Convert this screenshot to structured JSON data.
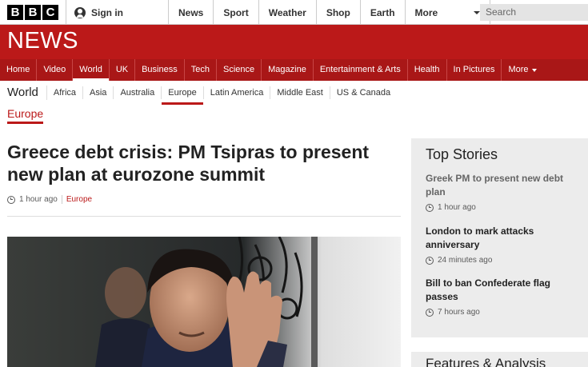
{
  "brand": {
    "logo_letters": [
      "B",
      "B",
      "C"
    ],
    "wordmark": "NEWS"
  },
  "masthead": {
    "signin": "Sign in",
    "nav": [
      "News",
      "Sport",
      "Weather",
      "Shop",
      "Earth"
    ],
    "more": "More",
    "search_placeholder": "Search"
  },
  "section_nav": {
    "items": [
      "Home",
      "Video",
      "World",
      "UK",
      "Business",
      "Tech",
      "Science",
      "Magazine",
      "Entertainment & Arts",
      "Health",
      "In Pictures"
    ],
    "more": "More",
    "active": "World"
  },
  "sub_nav": {
    "title": "World",
    "items": [
      "Africa",
      "Asia",
      "Australia",
      "Europe",
      "Latin America",
      "Middle East",
      "US & Canada"
    ],
    "active": "Europe"
  },
  "section_label": "Europe",
  "article": {
    "headline": "Greece debt crisis: PM Tsipras to present new plan at eurozone summit",
    "time": "1 hour ago",
    "tag": "Europe"
  },
  "sidebar": {
    "title": "Top Stories",
    "stories": [
      {
        "title": "Greek PM to present new debt plan",
        "time": "1 hour ago"
      },
      {
        "title": "London to mark attacks anniversary",
        "time": "24 minutes ago"
      },
      {
        "title": "Bill to ban Confederate flag passes",
        "time": "7 hours ago"
      }
    ],
    "next_title": "Features & Analysis"
  },
  "colors": {
    "brand_red": "#bb1919",
    "nav_red": "#a91717",
    "sidebar_bg": "#ececec"
  }
}
